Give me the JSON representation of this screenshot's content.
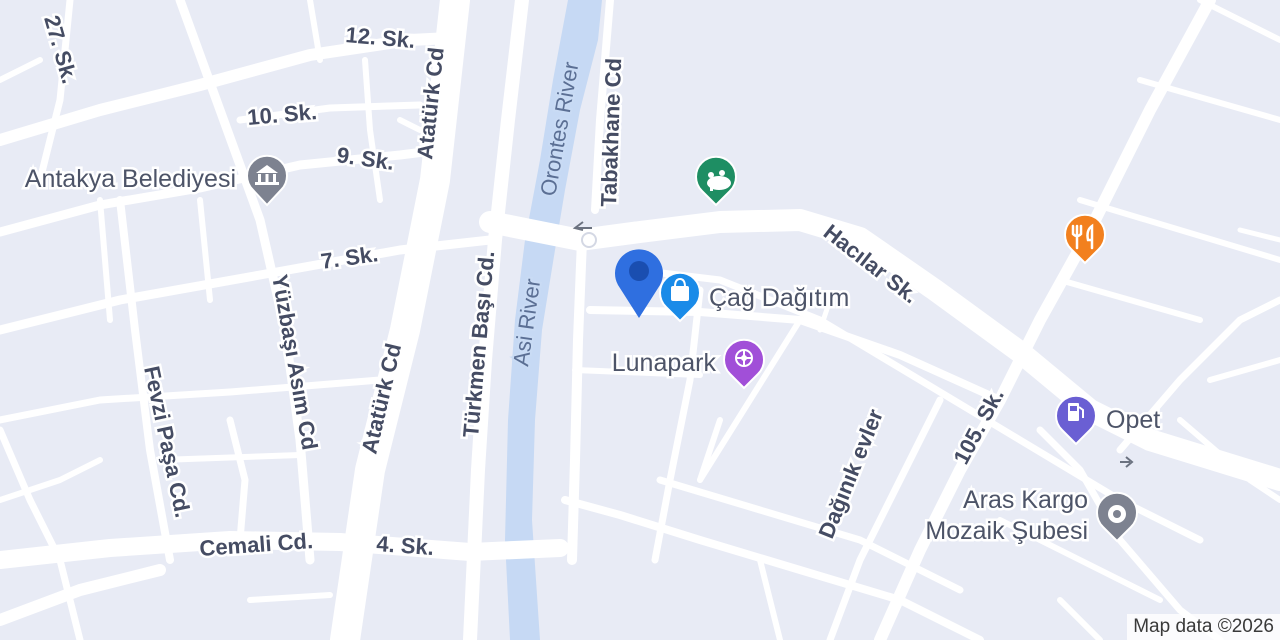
{
  "map": {
    "colors": {
      "background": "#e8ebf5",
      "road": "#ffffff",
      "river": "#c6d9f4",
      "location_pin": "#2f6fe0",
      "civic_marker": "#7d8290",
      "park_marker": "#1e8e63",
      "food_marker": "#f2801e",
      "shopping_marker": "#1a8be8",
      "entertainment_marker": "#a14fd8",
      "gas_marker": "#6a5fd3",
      "service_marker": "#7d8290"
    },
    "roads": {
      "r1": "12. Sk.",
      "r2": "27. Sk.",
      "r3": "10. Sk.",
      "r4": "9. Sk.",
      "r5": "Atatürk Cd",
      "r6": "7. Sk.",
      "r7": "Atatürk Cd",
      "r8": "Yüzbaşı Asım Cd",
      "r9": "Fevzi Paşa Cd.",
      "r10": "Cemali Cd.",
      "r11": "4. Sk.",
      "r12": "Türkmen Başı Cd.",
      "r13": "Tabakhane Cd",
      "r14": "Hacılar Sk.",
      "r15": "105. Sk.",
      "r16": "Dağınık evler"
    },
    "rivers": {
      "v1": "Orontes River",
      "v2": "Asi River"
    },
    "places": {
      "belediye": {
        "name": "Antakya Belediyesi",
        "icon": "civic-building-icon"
      },
      "cag": {
        "name": "Çağ Dağıtım",
        "icon": "shopping-bag-icon"
      },
      "luna": {
        "name": "Lunapark",
        "icon": "amusement-park-icon"
      },
      "opet": {
        "name": "Opet",
        "icon": "gas-pump-icon"
      },
      "aras_line1": "Aras Kargo",
      "aras_line2": "Mozaik Şubesi",
      "aras_icon": "generic-place-icon",
      "park_icon": "park-icon",
      "food_icon": "fork-knife-icon"
    },
    "current_location_icon": "location-pin-icon",
    "attribution": "Map data ©2026"
  }
}
